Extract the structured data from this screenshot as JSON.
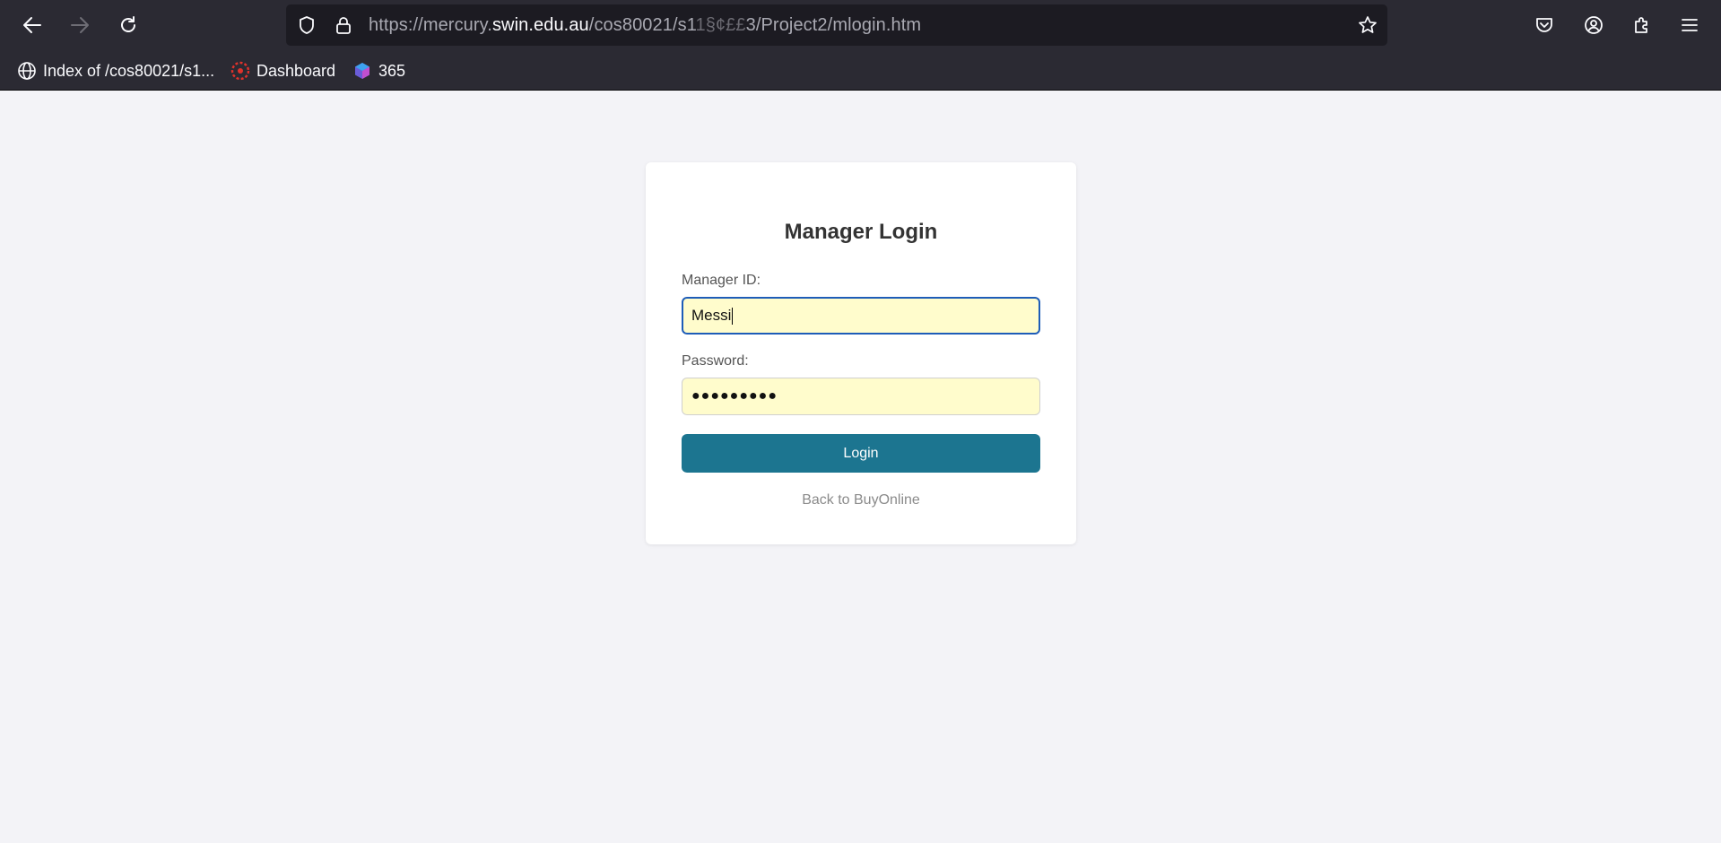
{
  "browser": {
    "url_prefix": "https://mercury.",
    "url_host": "swin.edu.au",
    "url_path": "/cos80021/s1",
    "url_obscured": "1§¢££",
    "url_suffix": "3/Project2/mlogin.htm",
    "icons": {
      "back": "arrow-left-icon",
      "forward": "arrow-right-icon",
      "reload": "reload-icon",
      "tracking": "shield-icon",
      "secure": "lock-icon",
      "bookmark": "star-icon",
      "pocket": "pocket-icon",
      "account": "account-icon",
      "extensions": "puzzle-icon",
      "menu": "hamburger-menu-icon"
    }
  },
  "bookmarks": [
    {
      "label": "Index of /cos80021/s1...",
      "icon": "globe-icon"
    },
    {
      "label": "Dashboard",
      "icon": "canvas-icon"
    },
    {
      "label": "365",
      "icon": "copilot-icon"
    }
  ],
  "login": {
    "title": "Manager Login",
    "manager_id_label": "Manager ID:",
    "manager_id_value": "Messi",
    "password_label": "Password:",
    "password_value": "●●●●●●●●●",
    "button_label": "Login",
    "back_link": "Back to BuyOnline"
  },
  "colors": {
    "chrome_bg": "#2b2a33",
    "urlbar_bg": "#1c1b22",
    "page_bg": "#f3f3f7",
    "field_bg": "#fffccc",
    "focus_border": "#1e5db8",
    "button_bg": "#1c7590"
  }
}
